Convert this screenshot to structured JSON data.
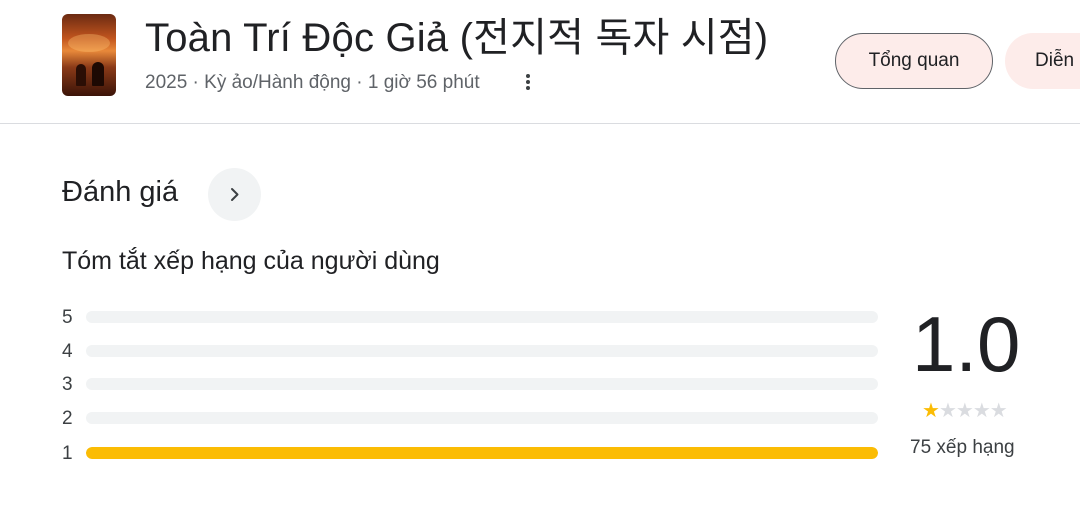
{
  "header": {
    "title": "Toàn Trí Độc Giả (전지적 독자 시점)",
    "meta": "2025 · Kỳ ảo/Hành động · 1 giờ 56 phút",
    "tabs": [
      {
        "label": "Tổng quan"
      },
      {
        "label": "Diễn"
      }
    ]
  },
  "ratings": {
    "section_title": "Đánh giá",
    "summary_title": "Tóm tắt xếp hạng của người dùng",
    "rows": [
      {
        "label": "5",
        "fraction": 0
      },
      {
        "label": "4",
        "fraction": 0
      },
      {
        "label": "3",
        "fraction": 0
      },
      {
        "label": "2",
        "fraction": 0
      },
      {
        "label": "1",
        "fraction": 1
      }
    ],
    "average": "1.0",
    "stars_filled": 1,
    "stars_total": 5,
    "count": "75 xếp hạng"
  },
  "colors": {
    "accent": "#fbbc04",
    "chip_bg": "#fdecea",
    "track": "#f1f3f4"
  },
  "icons": {
    "more": "kebab-vertical-icon",
    "expand": "chevron-right-icon"
  }
}
